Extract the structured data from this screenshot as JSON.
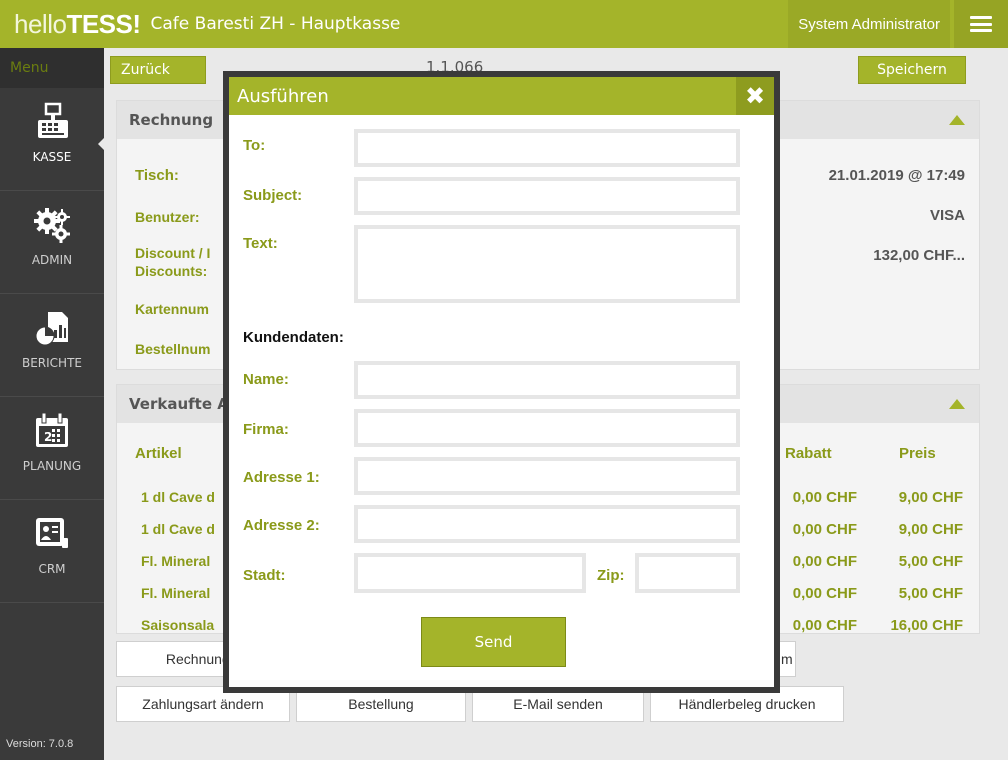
{
  "header": {
    "logo_light": "hello",
    "logo_bold": "TESS!",
    "title": "Cafe Baresti ZH - Hauptkasse",
    "user": "System Administrator",
    "menu_icon": "hamburger-icon"
  },
  "sidebar": {
    "menu_label": "Menu",
    "items": [
      {
        "label": "KASSE",
        "icon": "cash-register-icon"
      },
      {
        "label": "ADMIN",
        "icon": "gears-icon"
      },
      {
        "label": "BERICHTE",
        "icon": "report-chart-icon"
      },
      {
        "label": "PLANUNG",
        "icon": "calendar-icon"
      },
      {
        "label": "CRM",
        "icon": "contact-card-icon"
      }
    ],
    "version": "Version: 7.0.8"
  },
  "topbar": {
    "back_label": "Zurück",
    "number": "1.1.066",
    "save_label": "Speichern"
  },
  "invoice_panel": {
    "title": "Rechnung",
    "labels": {
      "table": "Tisch:",
      "user": "Benutzer:",
      "discount": "Discount / I",
      "discounts": "Discounts:",
      "card_number": "Kartennum",
      "order_number": "Bestellnum"
    },
    "values": {
      "datetime": "21.01.2019 @ 17:49",
      "payment": "VISA",
      "amount": "132,00 CHF..."
    }
  },
  "items_panel": {
    "title": "Verkaufte A",
    "col_article": "Artikel",
    "col_discount": "Rabatt",
    "col_price": "Preis",
    "rows": [
      {
        "article": "1 dl Cave d",
        "discount": "0,00 CHF",
        "price": "9,00 CHF"
      },
      {
        "article": "1 dl Cave d",
        "discount": "0,00 CHF",
        "price": "9,00 CHF"
      },
      {
        "article": "Fl. Mineral",
        "discount": "0,00 CHF",
        "price": "5,00 CHF"
      },
      {
        "article": "Fl. Mineral",
        "discount": "0,00 CHF",
        "price": "5,00 CHF"
      },
      {
        "article": "Saisonsala",
        "discount": "0,00 CHF",
        "price": "16,00 CHF"
      }
    ]
  },
  "bottom_buttons": {
    "row1": [
      "Rechnung dr",
      "m"
    ],
    "row2": [
      "Zahlungsart ändern",
      "Bestellung",
      "E-Mail senden",
      "Händlerbeleg drucken"
    ]
  },
  "modal": {
    "title": "Ausführen",
    "close_icon": "close-icon",
    "fields": {
      "to": {
        "label": "To:",
        "value": ""
      },
      "subject": {
        "label": "Subject:",
        "value": ""
      },
      "text": {
        "label": "Text:",
        "value": ""
      },
      "section": "Kundendaten:",
      "name": {
        "label": "Name:",
        "value": ""
      },
      "firma": {
        "label": "Firma:",
        "value": ""
      },
      "adresse1": {
        "label": "Adresse 1:",
        "value": ""
      },
      "adresse2": {
        "label": "Adresse 2:",
        "value": ""
      },
      "stadt": {
        "label": "Stadt:",
        "value": ""
      },
      "zip": {
        "label": "Zip:",
        "value": ""
      }
    },
    "send_label": "Send"
  },
  "colors": {
    "accent": "#a4b42a",
    "accent_dark": "#8e9c1f",
    "label_olive": "#8a9a1a",
    "sidebar": "#3a3a3a"
  }
}
